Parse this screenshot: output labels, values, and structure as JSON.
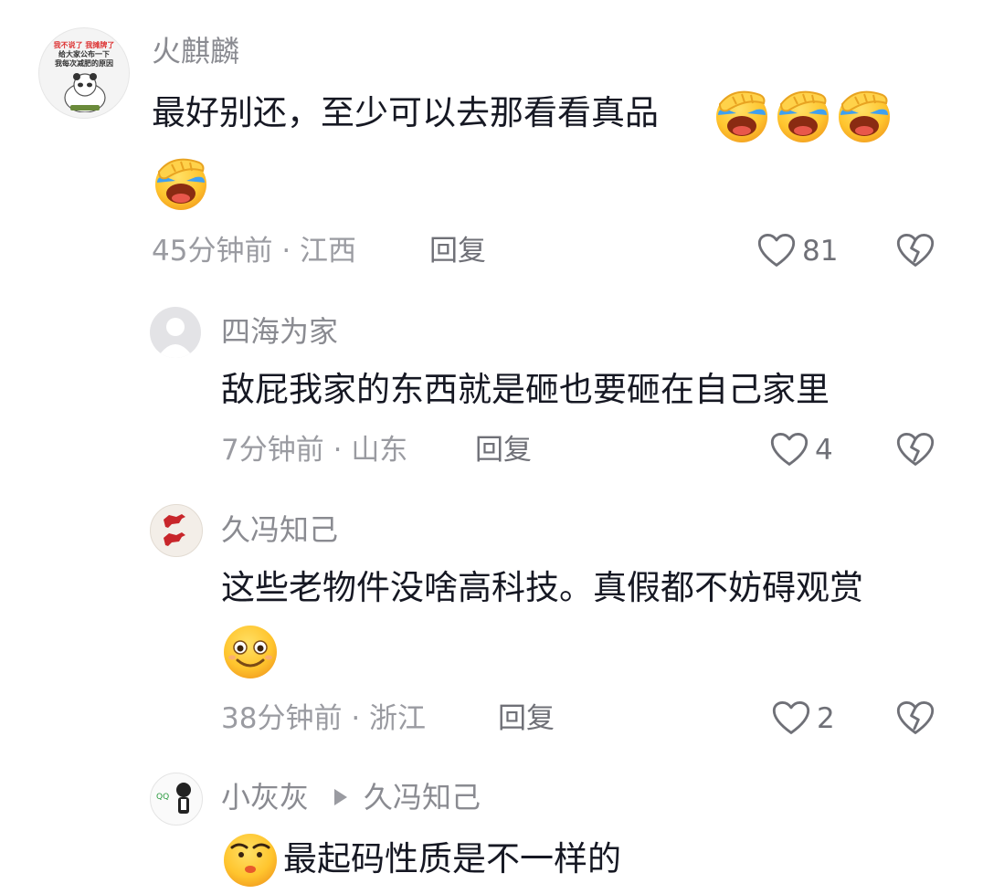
{
  "comments": [
    {
      "name": "火麒麟",
      "text": "最好别还，至少可以去那看看真品",
      "time": "45分钟前",
      "location": "江西",
      "reply_label": "回复",
      "likes": "81",
      "emoji": "facepalm-laugh-emoji",
      "avatar_text": [
        "我不说了 我摊牌了",
        "给大家公布一下",
        "我每次减肥的原因"
      ]
    },
    {
      "name": "四海为家",
      "text": "敌屁我家的东西就是砸也要砸在自己家里",
      "time": "7分钟前",
      "location": "山东",
      "reply_label": "回复",
      "likes": "4"
    },
    {
      "name": "久冯知己",
      "text": "这些老物件没啥高科技。真假都不妨碍观赏",
      "time": "38分钟前",
      "location": "浙江",
      "reply_label": "回复",
      "likes": "2",
      "emoji": "smile-emoji"
    },
    {
      "name": "小灰灰",
      "reply_to": "久冯知己",
      "text": "最起码性质是不一样的",
      "emoji": "smirk-emoji"
    }
  ],
  "colors": {
    "text": "#161823",
    "secondary": "#8a8b91",
    "background": "#ffffff"
  }
}
